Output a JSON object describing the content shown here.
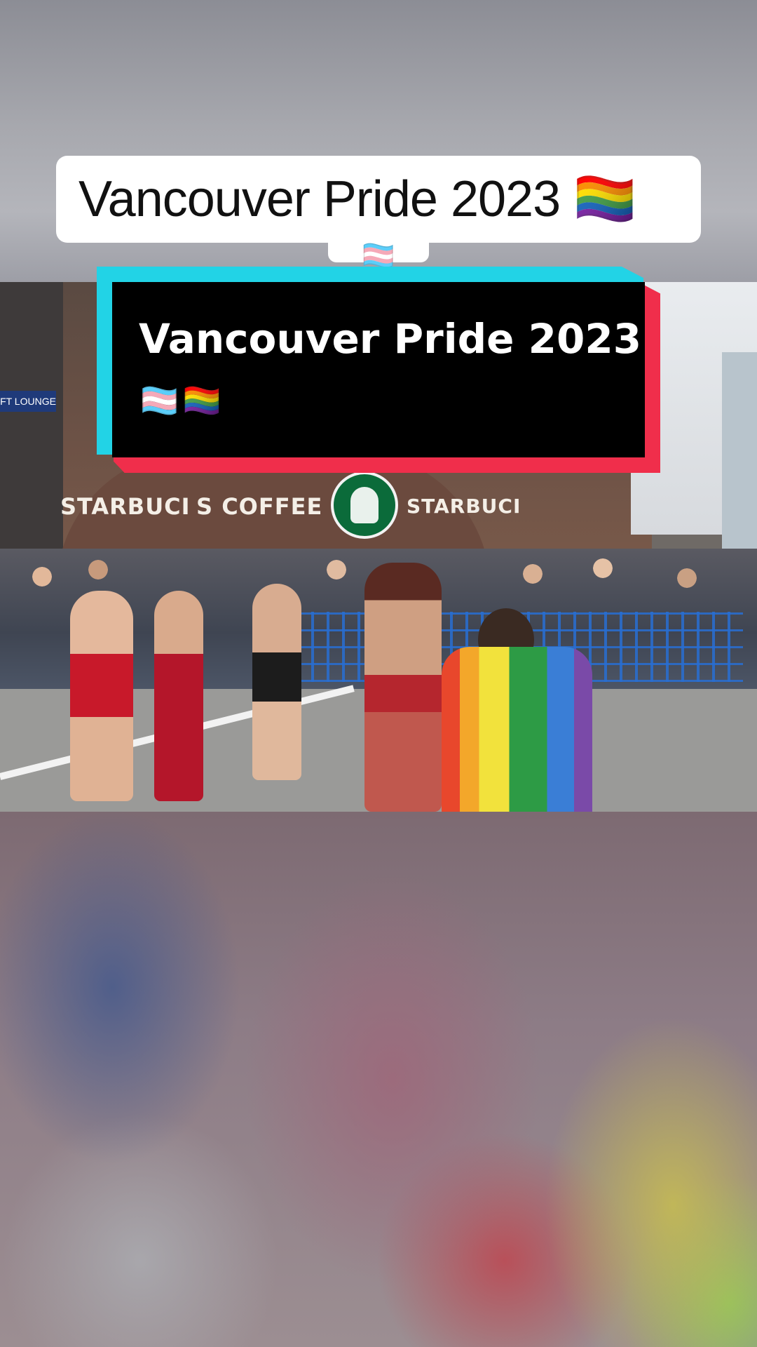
{
  "caption": {
    "text": "Vancouver Pride 2023 🏳️‍🌈",
    "tail_flag": "🏳️‍⚧️"
  },
  "overlay_title": {
    "text": "Vancouver Pride 2023",
    "flags": "🏳️‍⚧️🏳️‍🌈"
  },
  "scene": {
    "storefront_left": "STARBUCI",
    "storefront_coffee": "S COFFEE",
    "storefront_right": "STARBUCI",
    "lounge_sign": "FT LOUNGE"
  },
  "colors": {
    "glitch_cyan": "#22d3e6",
    "glitch_red": "#f02e4b",
    "title_box": "#000000"
  }
}
